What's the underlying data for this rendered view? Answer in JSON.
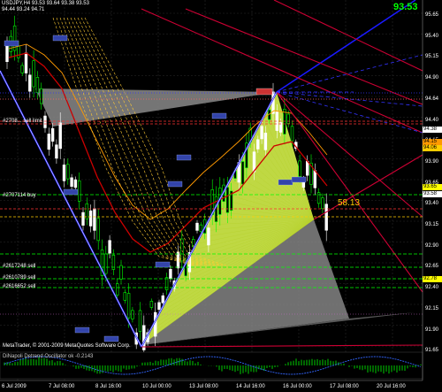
{
  "header": {
    "symbol_line": "USDJPY,H4  93.53 93.64 93.38 93.53",
    "sub_line": "94.44 93.24 94.71",
    "big_price": "93.53"
  },
  "orders": [
    {
      "label": "#2708... sell limit"
    },
    {
      "label": "#2707114 buy"
    },
    {
      "label": "#2617248 sell"
    },
    {
      "label": "#2610789 sell"
    },
    {
      "label": "#2616652 sell"
    }
  ],
  "annotation": "58.13",
  "footer": {
    "copyright": "MetaTrader, © 2001-2009 MetaQuotes Software Corp.",
    "indicator": "DiNapoli Detrend Oscillator ok  -0.2143"
  },
  "price_axis": {
    "ticks": [
      "95.65",
      "95.40",
      "95.15",
      "94.90",
      "94.64",
      "94.40",
      "94.15",
      "93.90",
      "93.65",
      "93.40",
      "93.15",
      "92.90",
      "92.65",
      "92.40",
      "92.15",
      "91.90",
      "91.65"
    ],
    "tags": [
      {
        "value": "94.38",
        "color": "#ffffff"
      },
      {
        "value": "94.15",
        "color": "#ff9900"
      },
      {
        "value": "94.06",
        "color": "#ffcc00"
      },
      {
        "value": "93.65",
        "color": "#ffff00"
      },
      {
        "value": "93.58",
        "color": "#ffffff"
      },
      {
        "value": "92.78",
        "color": "#ffff00"
      }
    ]
  },
  "date_axis": [
    "6 Jul 2009",
    "7 Jul 08:00",
    "8 Jul 16:00",
    "10 Jul 00:00",
    "13 Jul 08:00",
    "14 Jul 16:00",
    "16 Jul 00:00",
    "17 Jul 08:00",
    "20 Jul 16:00"
  ],
  "colors": {
    "bg": "#000000",
    "bull": "#00ff00",
    "bear": "#ffffff",
    "triangle_yellow": "#d4f04a",
    "fan_grey": "#808080",
    "line_blue": "#0000ff",
    "line_red": "#cc0033",
    "lime_grid": "#00cc00"
  }
}
